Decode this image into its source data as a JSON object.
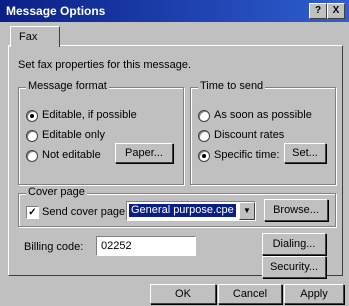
{
  "window": {
    "title": "Message Options",
    "help_label": "?",
    "close_label": "X"
  },
  "tabs": [
    {
      "label": "Fax"
    }
  ],
  "intro": "Set fax properties for this message.",
  "message_format": {
    "title": "Message format",
    "options": [
      "Editable, if possible",
      "Editable only",
      "Not editable"
    ],
    "selected": 0,
    "paper_button": "Paper..."
  },
  "time_to_send": {
    "title": "Time to send",
    "options": [
      "As soon as possible",
      "Discount rates",
      "Specific time:"
    ],
    "selected": 2,
    "set_button": "Set..."
  },
  "cover_page": {
    "title": "Cover page",
    "send_label": "Send cover page:",
    "checked": true,
    "selected_value": "General purpose.cpe",
    "browse_button": "Browse..."
  },
  "billing": {
    "label": "Billing code:",
    "value": "02252"
  },
  "buttons": {
    "dialing": "Dialing...",
    "security": "Security...",
    "ok": "OK",
    "cancel": "Cancel",
    "apply": "Apply"
  }
}
